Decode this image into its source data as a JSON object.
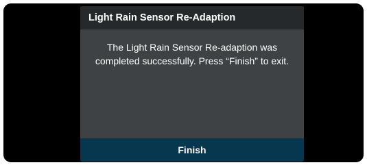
{
  "dialog": {
    "title": "Light Rain Sensor Re-Adaption",
    "message": "The Light Rain Sensor Re-adaption was completed successfully. Press “Finish” to exit.",
    "finish_label": "Finish"
  },
  "colors": {
    "screen_background": "#000000",
    "dialog_body": "#3f4244",
    "dialog_header": "#26292b",
    "button_background": "#07364f",
    "text": "#ffffff"
  }
}
